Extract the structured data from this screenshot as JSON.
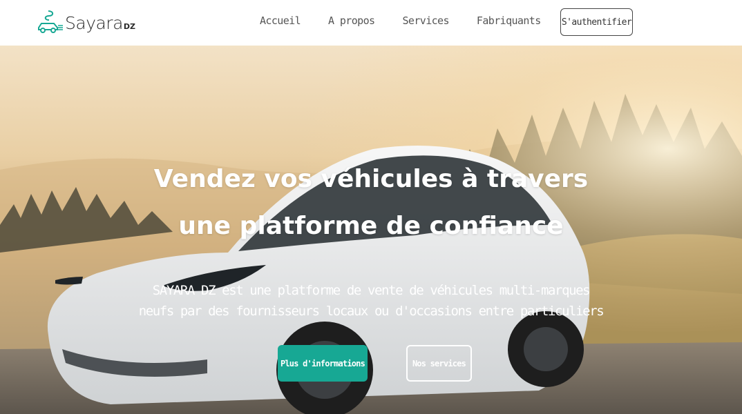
{
  "brand": {
    "name": "Sayara",
    "suffix": "DZ",
    "logo_icon": "car-logo-icon",
    "accent_color": "#17a894"
  },
  "nav": {
    "items": [
      {
        "label": "Accueil"
      },
      {
        "label": "A propos"
      },
      {
        "label": "Services"
      },
      {
        "label": "Fabriquants"
      }
    ],
    "auth_label": "S'authentifier"
  },
  "hero": {
    "title_line1": "Vendez vos véhicules à travers",
    "title_line2": "une platforme de confiance",
    "subtitle_line1": "SAYARA DZ est une platforme de vente de véhicules multi-marques",
    "subtitle_line2": "neufs par des fournisseurs locaux ou d'occasions entre particuliers",
    "primary_button": "Plus d'informations",
    "secondary_button": "Nos services"
  }
}
